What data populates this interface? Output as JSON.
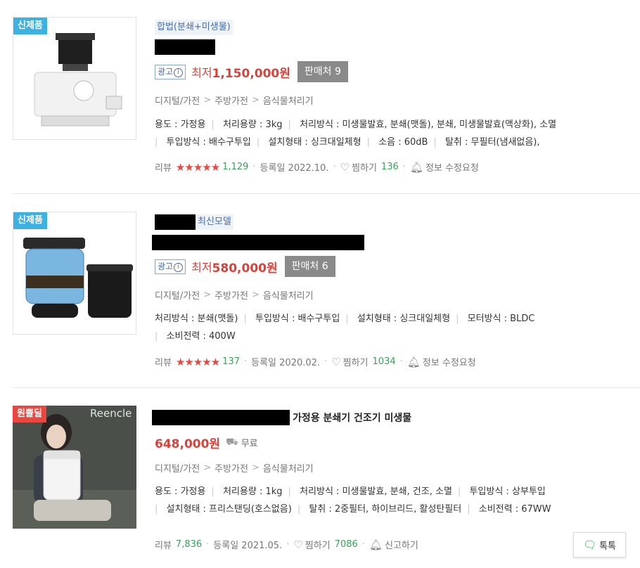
{
  "items": [
    {
      "badge": "신제품",
      "tag": "합법(분쇄+미생물)",
      "ad_label": "광고",
      "ad_info": "i",
      "price_prefix": "최저",
      "price": "1,150,000원",
      "seller_label": "판매처 9",
      "category": [
        "디지털/가전",
        "주방가전",
        "음식물처리기"
      ],
      "spec_line1": [
        "용도 : 가정용",
        "처리용량 : 3kg",
        "처리방식 : 미생물발효, 분쇄(맷돌), 분쇄, 미생물발효(액상화), 소멸"
      ],
      "spec_line2": [
        "투입방식 : 배수구투입",
        "설치형태 : 싱크대일체형",
        "소음 : 60dB",
        "탈취 : 무필터(냄새없음),"
      ],
      "review_label": "리뷰",
      "stars": "★★★★★",
      "review_count": "1,129",
      "reg_label": "등록일 2022.10.",
      "wish_label": "찜하기",
      "wish_count": "136",
      "report_label": "정보 수정요청"
    },
    {
      "badge": "신제품",
      "tag": "최신모델",
      "ad_label": "광고",
      "ad_info": "i",
      "price_prefix": "최저",
      "price": "580,000원",
      "seller_label": "판매처 6",
      "category": [
        "디지털/가전",
        "주방가전",
        "음식물처리기"
      ],
      "spec_line1": [
        "처리방식 : 분쇄(맷돌)",
        "투입방식 : 배수구투입",
        "설치형태 : 싱크대일체형",
        "모터방식 : BLDC"
      ],
      "spec_line2": [
        "소비전력 : 400W"
      ],
      "review_label": "리뷰",
      "stars": "★★★★★",
      "review_count": "137",
      "reg_label": "등록일 2020.02.",
      "wish_label": "찜하기",
      "wish_count": "1034",
      "report_label": "정보 수정요청"
    },
    {
      "badge": "원쁠딜",
      "image_brand": "Reencle",
      "title": "가정용 분쇄기 건조기 미생물",
      "price": "648,000원",
      "shipping": "무료",
      "category": [
        "디지털/가전",
        "주방가전",
        "음식물처리기"
      ],
      "spec_line1": [
        "용도 : 가정용",
        "처리용량 : 1kg",
        "처리방식 : 미생물발효, 분쇄, 건조, 소멸",
        "투입방식 : 상부투입"
      ],
      "spec_line2": [
        "설치형태 : 프리스탠딩(호스없음)",
        "탈취 : 2중필터, 하이브리드, 활성탄필터",
        "소비전력 : 67WW"
      ],
      "review_label": "리뷰",
      "review_count": "7,836",
      "reg_label": "등록일 2021.05.",
      "wish_label": "찜하기",
      "wish_count": "7086",
      "report_label": "신고하기"
    }
  ],
  "talk_button": "톡톡",
  "icons": {
    "heart": "heart-icon",
    "bell": "bell-icon",
    "truck": "truck-icon",
    "chat": "chat-icon"
  },
  "colors": {
    "price": "#d9423a",
    "new_badge": "#3db1e1",
    "deal_badge": "#e8483f",
    "count_green": "#3aa05a"
  }
}
